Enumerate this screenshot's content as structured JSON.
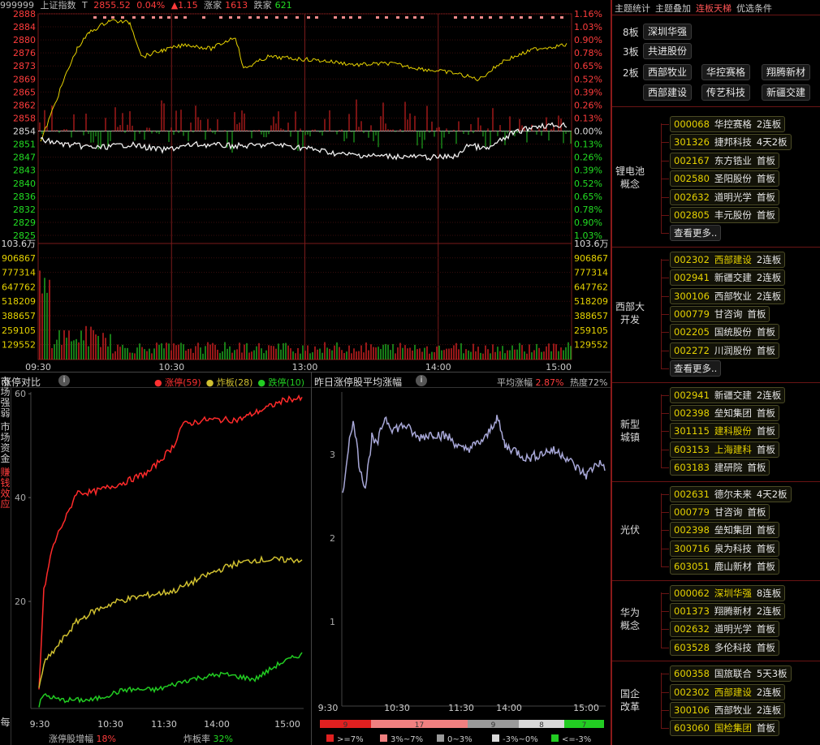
{
  "header": {
    "code": "999999",
    "name": "上证指数",
    "t_label": "T",
    "price": "2855.52",
    "pct": "0.04%",
    "change": "▲1.15",
    "up_label": "涨家",
    "up_count": "1613",
    "down_label": "跌家",
    "down_count": "621"
  },
  "price_axis_left": [
    "2888",
    "2884",
    "2880",
    "2876",
    "2873",
    "2869",
    "2865",
    "2862",
    "2858",
    "2854",
    "2851",
    "2847",
    "2843",
    "2840",
    "2836",
    "2832",
    "2829",
    "2825"
  ],
  "price_axis_right": [
    "1.16%",
    "1.03%",
    "0.90%",
    "0.78%",
    "0.65%",
    "0.52%",
    "0.39%",
    "0.26%",
    "0.13%",
    "0.00%",
    "0.13%",
    "0.26%",
    "0.39%",
    "0.52%",
    "0.65%",
    "0.78%",
    "0.90%",
    "1.03%"
  ],
  "vol_axis": [
    "103.6万",
    "906867",
    "777314",
    "647762",
    "518209",
    "388657",
    "259105",
    "129552"
  ],
  "time_axis": [
    "09:30",
    "10:30",
    "13:00",
    "14:00",
    "15:00"
  ],
  "limit_panel": {
    "title": "涨停对比",
    "legend": [
      {
        "label": "涨停(59)",
        "color": "#ff3030"
      },
      {
        "label": "炸板(28)",
        "color": "#d0c030"
      },
      {
        "label": "跌停(10)",
        "color": "#22cc22"
      }
    ],
    "y_ticks": [
      "60",
      "40",
      "20"
    ],
    "x_ticks": [
      "9:30",
      "10:30",
      "11:30",
      "14:00",
      "15:00"
    ],
    "footer_left_label": "涨停股增幅",
    "footer_left_value": "18%",
    "footer_right_label": "炸板率",
    "footer_right_value": "32%"
  },
  "side_tabs": [
    {
      "label": "市场强弱",
      "active": false
    },
    {
      "label": "市场资金",
      "active": false
    },
    {
      "label": "赚钱效应",
      "active": true
    },
    {
      "label": "每",
      "active": false
    }
  ],
  "yest_panel": {
    "title": "昨日涨停股平均涨幅",
    "avg_label": "平均涨幅",
    "avg_value": "2.87%",
    "heat_label": "热度72%",
    "y_ticks": [
      "3",
      "2",
      "1"
    ],
    "x_ticks": [
      "9:30",
      "10:30",
      "11:30",
      "14:00",
      "15:00"
    ],
    "dist": [
      {
        "count": "9",
        "color": "#e02020"
      },
      {
        "count": "17",
        "color": "#f08080"
      },
      {
        "count": "9",
        "color": "#9a9a9a"
      },
      {
        "count": "8",
        "color": "#d8d8d8"
      },
      {
        "count": "7",
        "color": "#22cc22"
      }
    ],
    "dist_legend": [
      {
        "label": ">=7%",
        "color": "#e02020"
      },
      {
        "label": "3%~7%",
        "color": "#f08080"
      },
      {
        "label": "0~3%",
        "color": "#9a9a9a"
      },
      {
        "label": "-3%~0%",
        "color": "#d8d8d8"
      },
      {
        "label": "<=-3%",
        "color": "#22cc22"
      }
    ]
  },
  "right_panel": {
    "tabs": [
      {
        "label": "主题统计",
        "active": false
      },
      {
        "label": "主题叠加",
        "active": false
      },
      {
        "label": "连板天梯",
        "active": true
      },
      {
        "label": "优选条件",
        "active": false
      }
    ],
    "ladder": [
      {
        "level": "8板",
        "stocks": [
          "深圳华强"
        ]
      },
      {
        "level": "3板",
        "stocks": [
          "共进股份"
        ]
      },
      {
        "level": "2板",
        "stocks": [
          "西部牧业",
          "华控赛格",
          "翔腾新材",
          "西部建设",
          "传艺科技",
          "新疆交建"
        ]
      }
    ],
    "more_label": "查看更多..",
    "groups": [
      {
        "name": "锂电池概念",
        "rows": [
          {
            "code": "000068",
            "name": "华控赛格",
            "board": "2连板",
            "hl": false
          },
          {
            "code": "301326",
            "name": "捷邦科技",
            "board": "4天2板",
            "hl": false
          },
          {
            "code": "002167",
            "name": "东方锆业",
            "board": "首板",
            "hl": false
          },
          {
            "code": "002580",
            "name": "圣阳股份",
            "board": "首板",
            "hl": false
          },
          {
            "code": "002632",
            "name": "道明光学",
            "board": "首板",
            "hl": false
          },
          {
            "code": "002805",
            "name": "丰元股份",
            "board": "首板",
            "hl": false
          }
        ],
        "more": true
      },
      {
        "name": "西部大开发",
        "rows": [
          {
            "code": "002302",
            "name": "西部建设",
            "board": "2连板",
            "hl": true
          },
          {
            "code": "002941",
            "name": "新疆交建",
            "board": "2连板",
            "hl": false
          },
          {
            "code": "300106",
            "name": "西部牧业",
            "board": "2连板",
            "hl": false
          },
          {
            "code": "000779",
            "name": "甘咨询",
            "board": "首板",
            "hl": false
          },
          {
            "code": "002205",
            "name": "国统股份",
            "board": "首板",
            "hl": false
          },
          {
            "code": "002272",
            "name": "川润股份",
            "board": "首板",
            "hl": false
          }
        ],
        "more": true
      },
      {
        "name": "新型城镇",
        "rows": [
          {
            "code": "002941",
            "name": "新疆交建",
            "board": "2连板",
            "hl": false
          },
          {
            "code": "002398",
            "name": "垒知集团",
            "board": "首板",
            "hl": false
          },
          {
            "code": "301115",
            "name": "建科股份",
            "board": "首板",
            "hl": true
          },
          {
            "code": "603153",
            "name": "上海建科",
            "board": "首板",
            "hl": true
          },
          {
            "code": "603183",
            "name": "建研院",
            "board": "首板",
            "hl": false
          }
        ],
        "more": false
      },
      {
        "name": "光伏",
        "rows": [
          {
            "code": "002631",
            "name": "德尔未来",
            "board": "4天2板",
            "hl": false
          },
          {
            "code": "000779",
            "name": "甘咨询",
            "board": "首板",
            "hl": false
          },
          {
            "code": "002398",
            "name": "垒知集团",
            "board": "首板",
            "hl": false
          },
          {
            "code": "300716",
            "name": "泉为科技",
            "board": "首板",
            "hl": false
          },
          {
            "code": "603051",
            "name": "鹿山新材",
            "board": "首板",
            "hl": false
          }
        ],
        "more": false
      },
      {
        "name": "华为概念",
        "rows": [
          {
            "code": "000062",
            "name": "深圳华强",
            "board": "8连板",
            "hl": true
          },
          {
            "code": "001373",
            "name": "翔腾新材",
            "board": "2连板",
            "hl": false
          },
          {
            "code": "002632",
            "name": "道明光学",
            "board": "首板",
            "hl": false
          },
          {
            "code": "603528",
            "name": "多伦科技",
            "board": "首板",
            "hl": false
          }
        ],
        "more": false
      },
      {
        "name": "国企改革",
        "rows": [
          {
            "code": "600358",
            "name": "国旅联合",
            "board": "5天3板",
            "hl": false
          },
          {
            "code": "002302",
            "name": "西部建设",
            "board": "2连板",
            "hl": true
          },
          {
            "code": "300106",
            "name": "西部牧业",
            "board": "2连板",
            "hl": false
          },
          {
            "code": "603060",
            "name": "国检集团",
            "board": "首板",
            "hl": true
          }
        ],
        "more": false
      }
    ]
  }
}
